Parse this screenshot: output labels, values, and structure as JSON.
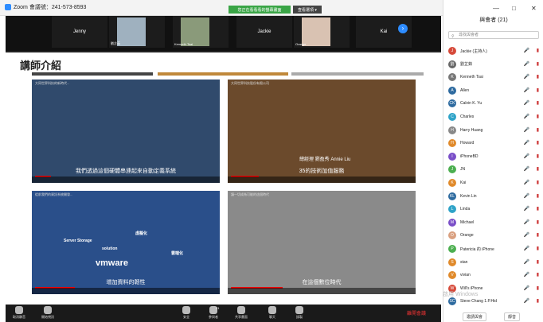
{
  "window": {
    "title": "Zoom 會議號：241-573-8593",
    "viewing_label": "您正在看看看的螢幕畫面",
    "view_options": "查看選項 ▾"
  },
  "thumbnails": [
    {
      "name": "Jenny",
      "kind": "text"
    },
    {
      "name": "劉芷茹",
      "kind": "face",
      "color": "#9fb1bf"
    },
    {
      "name": "Kenneth Tsai",
      "kind": "face",
      "color": "#8a9a7a"
    },
    {
      "name": "Jackie",
      "kind": "text"
    },
    {
      "name": "Orange",
      "kind": "face",
      "color": "#d9c2b2"
    },
    {
      "name": "Kai",
      "kind": "text"
    }
  ],
  "slide": {
    "heading": "講師介紹",
    "videos": [
      {
        "title": "大同世界科技的新時代...",
        "subtitle": "我們透過這個硬體串連起來自動定義系統",
        "bg": "#304a6c"
      },
      {
        "title": "大同世界科技股份有限公司",
        "subtitle": "35的技術加值服務",
        "caption": "總經理 劉盈秀 Annie Liu",
        "bg": "#6b4a2c"
      },
      {
        "title": "從前我們的資訊系統開發...",
        "subtitle": "增加資料的韌性",
        "labels": [
          "Server Storage",
          "虛擬化",
          "雲端化",
          "vmware",
          "solution"
        ],
        "bg": "#2a4f8a"
      },
      {
        "title": "讓一切成為可能的這個時代",
        "subtitle": "在這個數位時代",
        "bg": "#8a8a8a"
      }
    ]
  },
  "toolbar": {
    "items": [
      "取消靜音",
      "開始視訊",
      "安全",
      "參與者",
      "共享畫面",
      "聊天",
      "錄製"
    ],
    "participant_count": "21",
    "end": "離開會議"
  },
  "panel": {
    "title": "與會者 (21)",
    "search_placeholder": "尋找與會者",
    "participants": [
      {
        "name": "Jackie (主持人)",
        "initial": "J",
        "color": "#d64a3a"
      },
      {
        "name": "劉芷茹",
        "initial": "劉",
        "color": "#666"
      },
      {
        "name": "Kenneth Tsai",
        "initial": "K",
        "color": "#777"
      },
      {
        "name": "Allen",
        "initial": "A",
        "color": "#2d6a9f"
      },
      {
        "name": "Calvin K. Yu",
        "initial": "CK",
        "color": "#2d6a9f"
      },
      {
        "name": "Charles",
        "initial": "C",
        "color": "#2fa3c8"
      },
      {
        "name": "Harry Huang",
        "initial": "H",
        "color": "#888"
      },
      {
        "name": "Howard",
        "initial": "H",
        "color": "#e08a2b"
      },
      {
        "name": "iPhoneBD",
        "initial": "I",
        "color": "#7a4fc8"
      },
      {
        "name": "JN",
        "initial": "J",
        "color": "#4caf50"
      },
      {
        "name": "Kai",
        "initial": "K",
        "color": "#e08a2b"
      },
      {
        "name": "Kevin Lin",
        "initial": "KL",
        "color": "#2d6a9f"
      },
      {
        "name": "Linda",
        "initial": "L",
        "color": "#2fa3c8"
      },
      {
        "name": "Michael",
        "initial": "M",
        "color": "#7a4fc8"
      },
      {
        "name": "Orange",
        "initial": "O",
        "color": "#d9a080"
      },
      {
        "name": "Patericia 的 iPhone",
        "initial": "P",
        "color": "#4caf50"
      },
      {
        "name": "stan",
        "initial": "S",
        "color": "#e08a2b"
      },
      {
        "name": "vivian",
        "initial": "V",
        "color": "#e08a2b"
      },
      {
        "name": "Will's iPhone",
        "initial": "W",
        "color": "#d64a3a"
      },
      {
        "name": "Steve Chang 1.P.Hid",
        "initial": "SC",
        "color": "#2d6a9f"
      }
    ],
    "invite": "邀請與會",
    "mute_all": "靜音"
  },
  "watermark": "啟用 Windows"
}
